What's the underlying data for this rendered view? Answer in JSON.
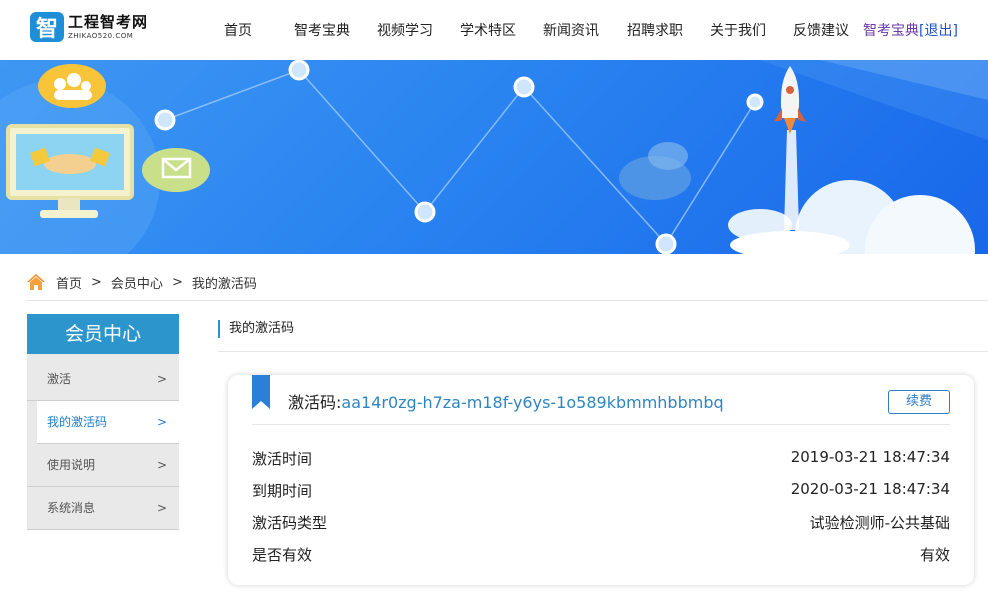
{
  "header": {
    "logo_glyph": "智",
    "logo_name": "工程智考网",
    "logo_sub": "ZHIKAO520.COM",
    "nav": [
      "首页",
      "智考宝典",
      "视频学习",
      "学术特区",
      "新闻资讯",
      "招聘求职",
      "关于我们",
      "反馈建议"
    ],
    "user_name": "智考宝典",
    "logout_open": "[",
    "logout_label": "退出",
    "logout_close": "]"
  },
  "breadcrumb": {
    "items": [
      "首页",
      "会员中心",
      "我的激活码"
    ],
    "separator": ">"
  },
  "sidebar": {
    "title": "会员中心",
    "items": [
      {
        "label": "激活",
        "chevron": ">"
      },
      {
        "label": "我的激活码",
        "chevron": ">"
      },
      {
        "label": "使用说明",
        "chevron": ">"
      },
      {
        "label": "系统消息",
        "chevron": ">"
      }
    ],
    "active_index": 1
  },
  "main": {
    "title": "我的激活码",
    "card": {
      "code_label": "激活码:",
      "code_value": "aa14r0zg-h7za-m18f-y6ys-1o589kbmmhbbmbq",
      "renew_label": "续费",
      "rows": [
        {
          "label": "激活时间",
          "value": "2019-03-21 18:47:34"
        },
        {
          "label": "到期时间",
          "value": "2020-03-21 18:47:34"
        },
        {
          "label": "激活码类型",
          "value": "试验检测师-公共基础"
        },
        {
          "label": "是否有效",
          "value": "有效"
        }
      ]
    }
  },
  "colors": {
    "accent": "#2c95cc",
    "link": "#2e86c1",
    "banner_blue": "#2a84f0",
    "user_purple": "#6a3aa8"
  }
}
